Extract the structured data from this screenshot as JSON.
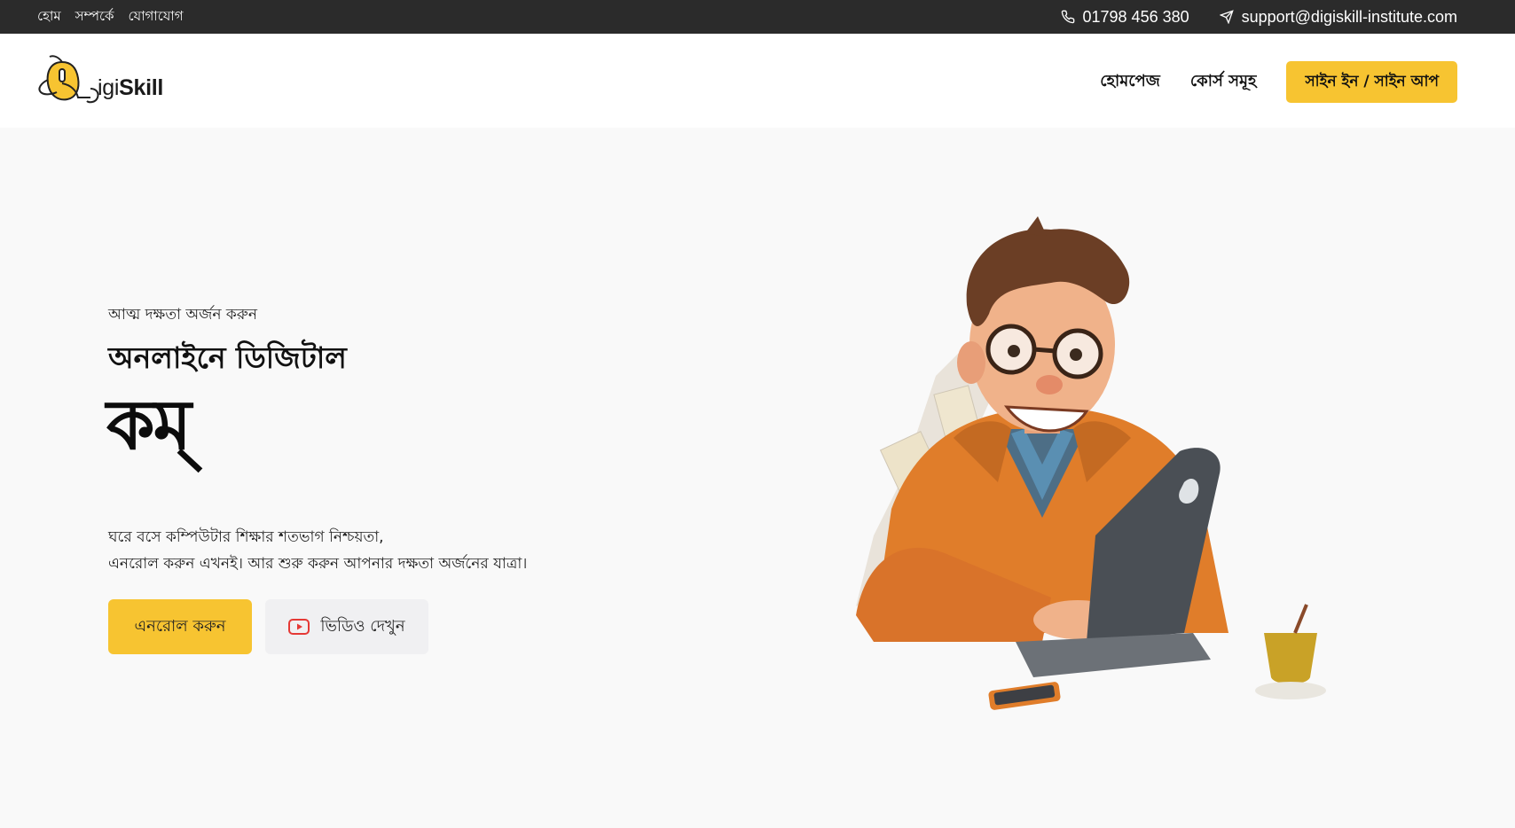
{
  "topbar": {
    "links": [
      "হোম",
      "সম্পর্কে",
      "যোগাযোগ"
    ],
    "phone": "01798 456 380",
    "email": "support@digiskill-institute.com"
  },
  "header": {
    "logo": {
      "light": "igi",
      "bold": "Skill"
    },
    "nav": {
      "home": "হোমপেজ",
      "courses": "কোর্স সমূহ",
      "signin": "সাইন ইন / সাইন আপ"
    }
  },
  "hero": {
    "tagline": "আত্ম দক্ষতা অর্জন করুন",
    "heading": "অনলাইনে ডিজিটাল",
    "typed": "কম্",
    "description_line1": "ঘরে বসে কম্পিউটার শিক্ষার শতভাগ নিশ্চয়তা,",
    "description_line2": "এনরোল করুন এখনই। আর শুরু করুন আপনার দক্ষতা অর্জনের যাত্রা।",
    "enroll_button": "এনরোল করুন",
    "video_button": "ভিডিও দেখুন"
  },
  "colors": {
    "accent": "#f7c431",
    "topbar": "#2b2b2b",
    "youtube": "#e53935"
  },
  "icons": {
    "phone": "phone-icon",
    "email": "send-icon",
    "video": "youtube-icon"
  }
}
